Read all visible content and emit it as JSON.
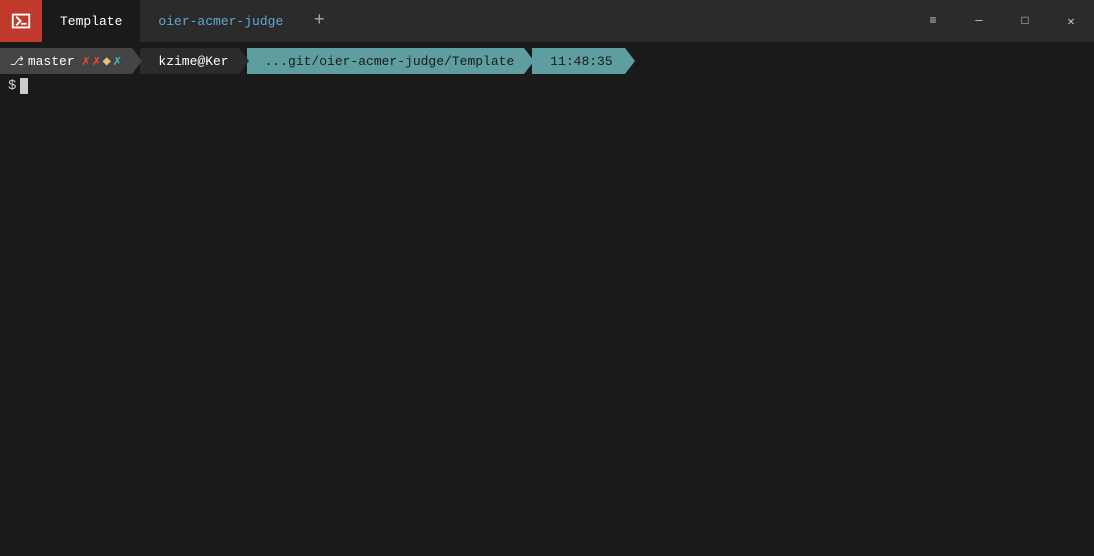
{
  "titlebar": {
    "logo_alt": "terminal-logo",
    "tabs": [
      {
        "id": "tab-template",
        "label": "Template",
        "active": true
      },
      {
        "id": "tab-oier",
        "label": "oier-acmer-judge",
        "active": false
      }
    ],
    "new_tab_label": "+",
    "controls": {
      "minimize": "─",
      "maximize": "□",
      "close": "✕",
      "menu": "≡"
    }
  },
  "terminal": {
    "git_branch": "master",
    "git_icons": [
      "✗",
      "✗",
      "◆",
      "✗"
    ],
    "user": "kzime@Ker",
    "path": "...git/oier-acmer-judge/Template",
    "time": "11:48:35",
    "shell_prompt": "$"
  }
}
